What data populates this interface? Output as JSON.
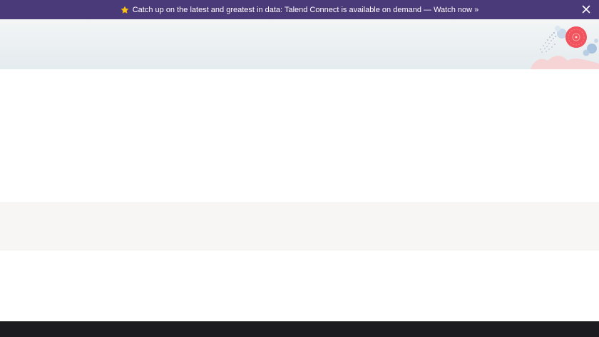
{
  "banner": {
    "icon": "star-icon",
    "text": "Catch up on the latest and greatest in data: Talend Connect is available on demand — Watch now »",
    "close_icon": "close-icon",
    "background": "#4b3a7a"
  },
  "hero": {
    "illustration": "decorative-bubbles-illustration"
  },
  "colors": {
    "band": "#f7f6f4",
    "footer": "#1c1c20",
    "accent_red": "#f0535d"
  }
}
